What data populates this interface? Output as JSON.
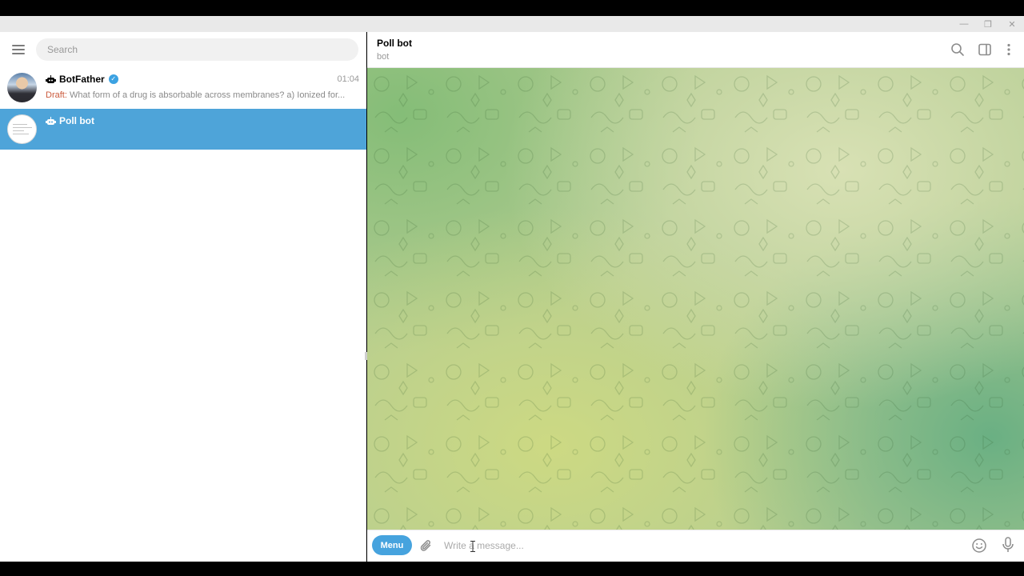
{
  "window": {
    "minimize_glyph": "—",
    "maximize_glyph": "❐",
    "close_glyph": "✕"
  },
  "sidebar": {
    "menu_icon": "hamburger-icon",
    "search": {
      "placeholder": "Search",
      "value": ""
    },
    "chats": [
      {
        "name": "BotFather",
        "is_bot": true,
        "verified": true,
        "time": "01:04",
        "draft_label": "Draft:",
        "preview": "What form of a drug is absorbable across membranes?  a) Ionized for..."
      },
      {
        "name": "Poll bot",
        "is_bot": true,
        "selected": true
      }
    ]
  },
  "chat": {
    "title": "Poll bot",
    "subtitle": "bot",
    "header_icons": [
      "search-icon",
      "side-panel-icon",
      "more-vertical-icon"
    ]
  },
  "composer": {
    "menu_label": "Menu",
    "placeholder": "Write a message...",
    "value": "",
    "icons": [
      "paperclip-icon",
      "emoji-icon",
      "microphone-icon"
    ]
  },
  "colors": {
    "accent": "#46a3de",
    "selected_row": "#4ea4d9",
    "draft": "#cb5a3c",
    "verified": "#3ca2e2"
  }
}
